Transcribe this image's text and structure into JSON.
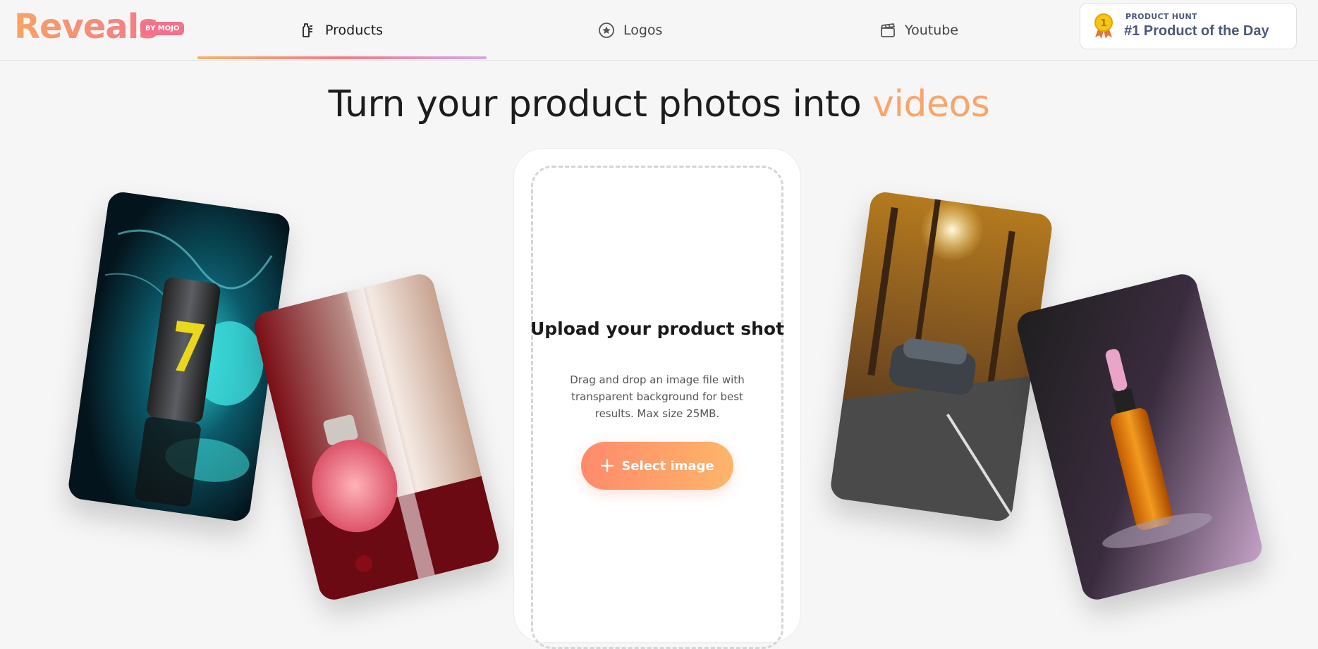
{
  "brand": {
    "name": "Reveals",
    "badge": "BY MOJO"
  },
  "nav": {
    "tabs": [
      {
        "label": "Products",
        "icon": "bottle-icon",
        "active": true
      },
      {
        "label": "Logos",
        "icon": "star-circle-icon",
        "active": false
      },
      {
        "label": "Youtube",
        "icon": "clapperboard-icon",
        "active": false
      }
    ]
  },
  "product_hunt": {
    "label": "PRODUCT HUNT",
    "title": "#1 Product of the Day",
    "medal_number": "1"
  },
  "hero": {
    "headline_main": "Turn your product photos into ",
    "headline_accent": "videos"
  },
  "upload": {
    "title": "Upload your product shot",
    "description": "Drag and drop an image file with transparent background for best results. Max size 25MB.",
    "button_label": "Select image"
  },
  "colors": {
    "accent_orange": "#f8a56c",
    "accent_pink": "#f07a8c",
    "product_hunt_text": "#4b587c"
  },
  "showcase": [
    {
      "subject": "energy drink can",
      "icon": "can-photo"
    },
    {
      "subject": "perfume bottle",
      "icon": "perfume-photo"
    },
    {
      "subject": "car on road",
      "icon": "car-photo"
    },
    {
      "subject": "serum dropper bottle",
      "icon": "serum-photo"
    }
  ]
}
